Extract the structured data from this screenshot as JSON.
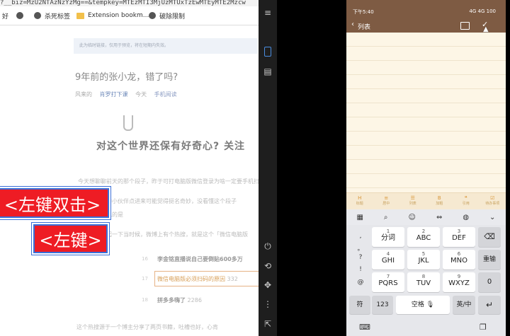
{
  "browser": {
    "url_fragment": "?__biz=MzU2NTAzNzYzMg==&tempkey=MTEzMTI3MjUzMTUxTzEwMTEyMTE2Mzcw",
    "bookmarks": [
      {
        "label": "好"
      },
      {
        "label": ""
      },
      {
        "label": "杀死标签"
      },
      {
        "label": "Extension bookm..."
      },
      {
        "label": "破除限制"
      }
    ],
    "article": {
      "notice": "此为临时链接，仅用于预览，将在短期内失效。",
      "title": "9年前的张小龙，错了吗?",
      "meta": [
        "风来的",
        "肖罗打下课",
        "今天",
        "手机阅读"
      ],
      "headline": "对这个世界还保有好奇心? 关注",
      "paragraphs": [
        "今天想聊聊前天的那个段子，昨于可打电脑版微信登录为啥一定要手机扫",
        "中小伙伴点进来可能觉得挺名奇妙，没看懂这个段子",
        "说的是",
        "起一下当时候，微博上有个热搜，就是这个「微信电脑版"
      ],
      "list": [
        {
          "num": "16",
          "text": "李金铭直播说自己要倒贴600多万"
        },
        {
          "num": "17",
          "text": "微信电脑版必须扫码的原因",
          "extra": "332"
        },
        {
          "num": "18",
          "text": "拼多多嗨了",
          "extra": "2286"
        }
      ],
      "bottom": "这个热搜源于一个博主分享了两页书籍，吐槽也好，心肯"
    },
    "badges": {
      "double": "<左键双击>",
      "single": "<左键>"
    }
  },
  "phone": {
    "status": {
      "time": "下午5:40",
      "right": "4G 4G 100"
    },
    "app_bar": {
      "back": "‹",
      "title": "列表"
    },
    "format_bar": [
      {
        "icon": "H",
        "label": "标题"
      },
      {
        "icon": "≡",
        "label": "居中"
      },
      {
        "icon": "☰",
        "label": "列表"
      },
      {
        "icon": "B",
        "label": "加粗"
      },
      {
        "icon": "❝",
        "label": "引用"
      },
      {
        "icon": "☑",
        "label": "待办事项"
      }
    ],
    "keyboard": {
      "side_keys": [
        ",",
        "。",
        "?",
        "!",
        "@"
      ],
      "rows": [
        [
          {
            "top": "1",
            "main": "分词"
          },
          {
            "top": "2",
            "main": "ABC"
          },
          {
            "top": "3",
            "main": "DEF"
          }
        ],
        [
          {
            "top": "4",
            "main": "GHI"
          },
          {
            "top": "5",
            "main": "JKL"
          },
          {
            "top": "6",
            "main": "MNO"
          }
        ],
        [
          {
            "top": "7",
            "main": "PQRS"
          },
          {
            "top": "8",
            "main": "TUV"
          },
          {
            "top": "9",
            "main": "WXYZ"
          }
        ]
      ],
      "right_keys": [
        "⌫",
        "重输",
        "0"
      ],
      "bottom": {
        "symbol": "符",
        "num": "123",
        "space": "空格",
        "lang": "英/中",
        "enter": "↵"
      }
    }
  },
  "colors": {
    "phone_bar": "#7e5b43",
    "badge_red": "#ee1c24",
    "accent_orange": "#d8973a"
  }
}
